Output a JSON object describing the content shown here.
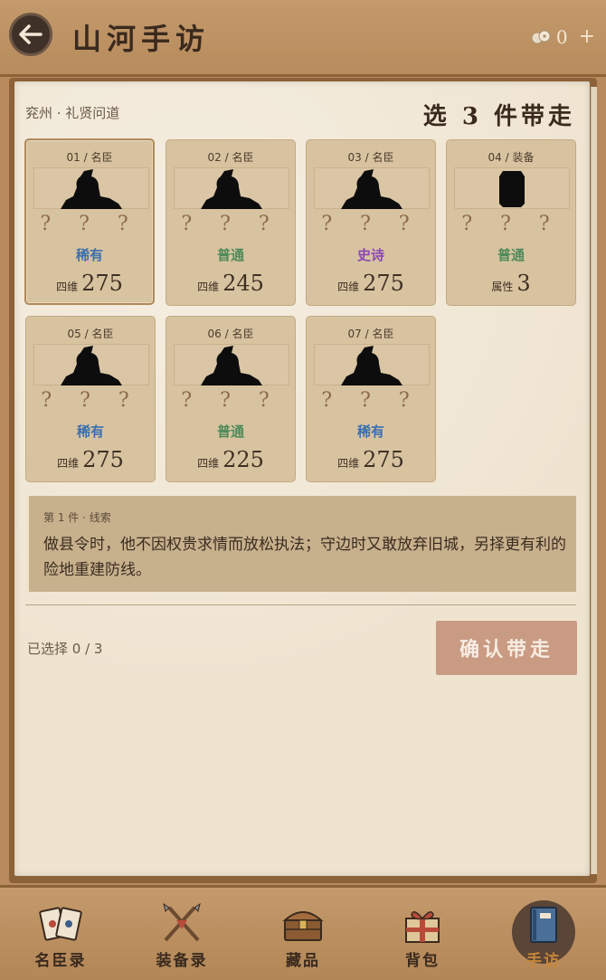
{
  "header": {
    "title": "山河手访",
    "coin_count": "0"
  },
  "location": "兖州 · 礼贤问道",
  "pick_title": "选 3 件带走",
  "cards": [
    {
      "head": "01 / 名臣",
      "qmarks": "? ? ?",
      "rarity": "稀有",
      "rarity_color": "#3a6fb0",
      "stat_label": "四维",
      "stat_value": "275",
      "type": "person"
    },
    {
      "head": "02 / 名臣",
      "qmarks": "? ? ?",
      "rarity": "普通",
      "rarity_color": "#4f8a5a",
      "stat_label": "四维",
      "stat_value": "245",
      "type": "person"
    },
    {
      "head": "03 / 名臣",
      "qmarks": "? ? ?",
      "rarity": "史诗",
      "rarity_color": "#8a47b6",
      "stat_label": "四维",
      "stat_value": "275",
      "type": "person"
    },
    {
      "head": "04 / 装备",
      "qmarks": "? ? ?",
      "rarity": "普通",
      "rarity_color": "#4f8a5a",
      "stat_label": "属性",
      "stat_value": "3",
      "type": "equip"
    },
    {
      "head": "05 / 名臣",
      "qmarks": "? ? ?",
      "rarity": "稀有",
      "rarity_color": "#3a6fb0",
      "stat_label": "四维",
      "stat_value": "275",
      "type": "person"
    },
    {
      "head": "06 / 名臣",
      "qmarks": "? ? ?",
      "rarity": "普通",
      "rarity_color": "#4f8a5a",
      "stat_label": "四维",
      "stat_value": "225",
      "type": "person"
    },
    {
      "head": "07 / 名臣",
      "qmarks": "? ? ?",
      "rarity": "稀有",
      "rarity_color": "#3a6fb0",
      "stat_label": "四维",
      "stat_value": "275",
      "type": "person"
    }
  ],
  "clue": {
    "label": "第 1 件 · 线索",
    "text": "做县令时，他不因权贵求情而放松执法；守边时又敢放弃旧城，另择更有利的险地重建防线。"
  },
  "selected_count": "已选择 0 / 3",
  "confirm_label": "确认带走",
  "nav": [
    {
      "label": "名臣录",
      "icon": "cards-icon"
    },
    {
      "label": "装备录",
      "icon": "weapons-icon"
    },
    {
      "label": "藏品",
      "icon": "treasure-chest-icon"
    },
    {
      "label": "背包",
      "icon": "gift-package-icon"
    },
    {
      "label": "手访",
      "icon": "book-icon",
      "active": true
    }
  ]
}
